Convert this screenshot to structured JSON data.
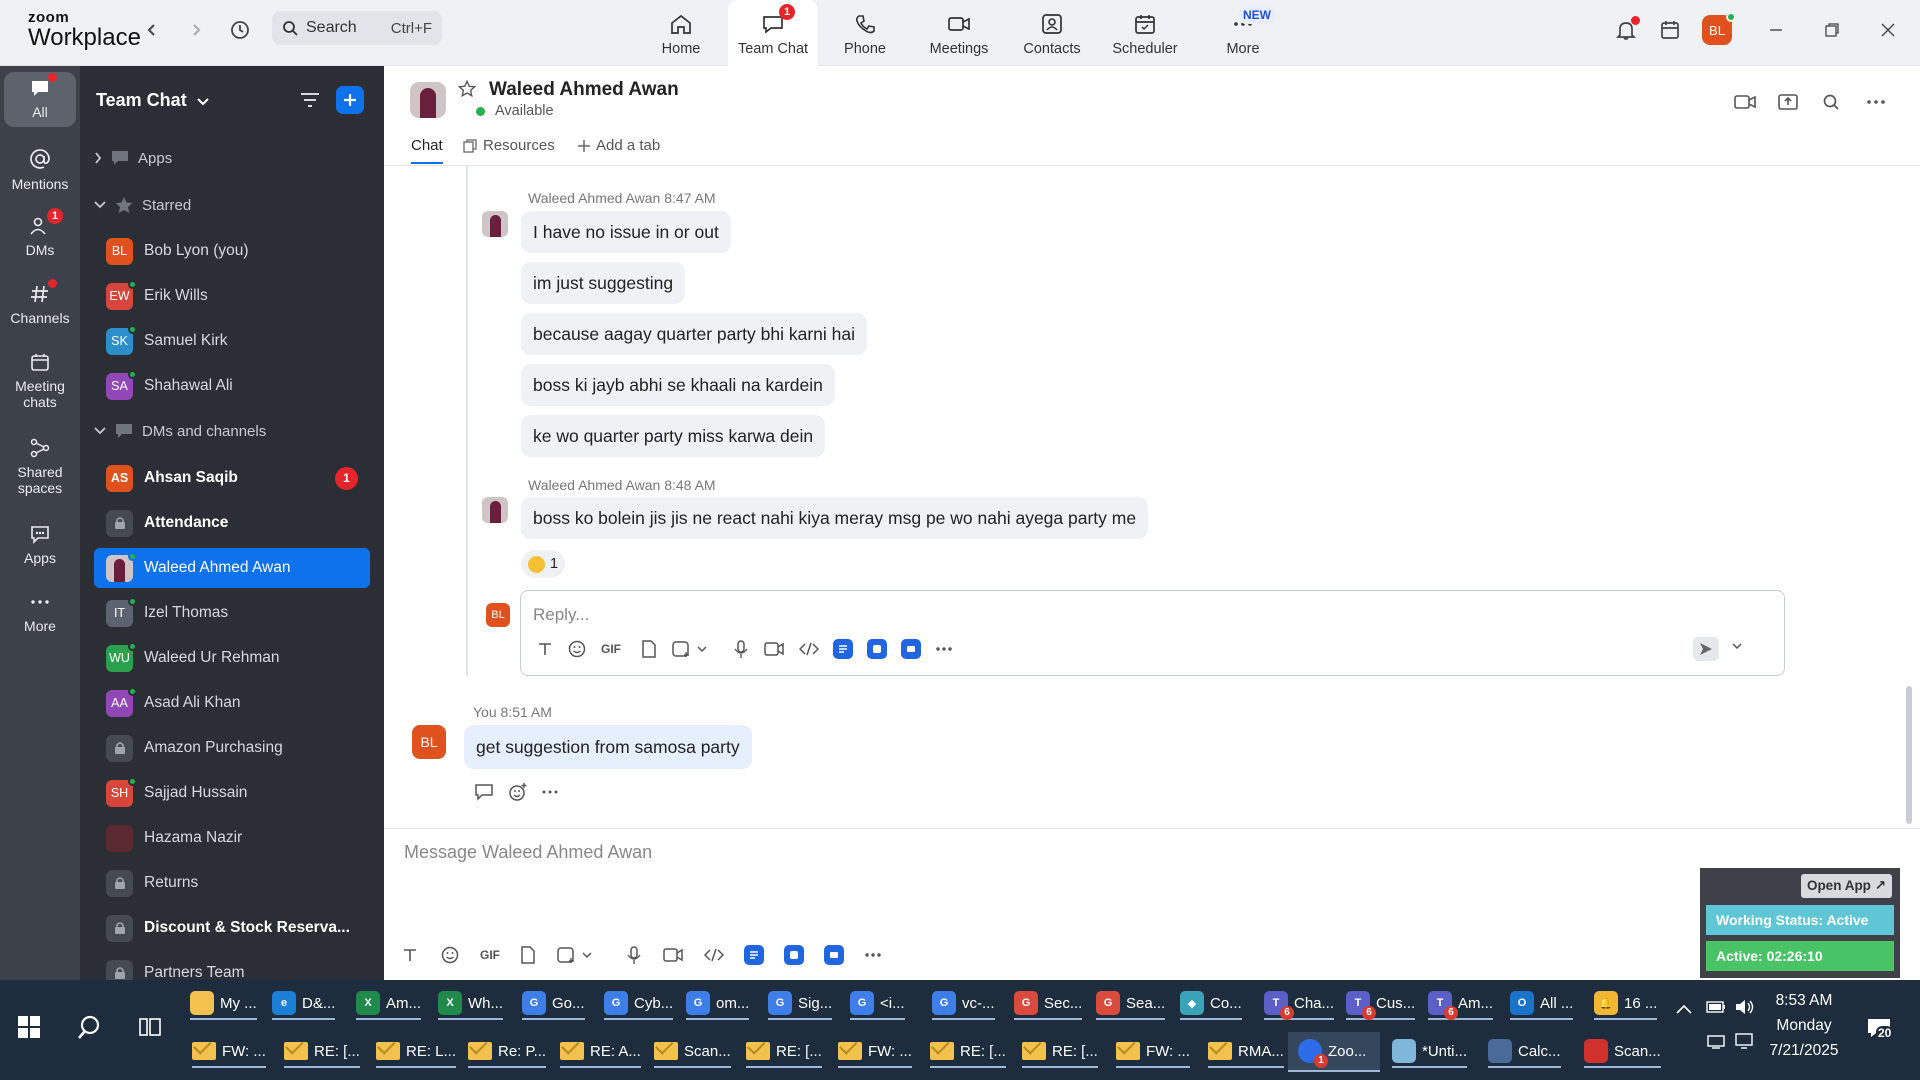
{
  "app": {
    "logo_line1": "zoom",
    "logo_line2": "Workplace"
  },
  "search": {
    "placeholder": "Search",
    "shortcut": "Ctrl+F"
  },
  "nav": [
    {
      "label": "Home",
      "icon": "home-icon"
    },
    {
      "label": "Team Chat",
      "icon": "chat-bubble-icon",
      "badge": "1",
      "active": true
    },
    {
      "label": "Phone",
      "icon": "phone-icon"
    },
    {
      "label": "Meetings",
      "icon": "video-camera-icon"
    },
    {
      "label": "Contacts",
      "icon": "contacts-icon"
    },
    {
      "label": "Scheduler",
      "icon": "calendar-icon"
    },
    {
      "label": "More",
      "icon": "more-icon",
      "new_badge": "NEW"
    }
  ],
  "user": {
    "initials": "BL",
    "color": "#e0521d"
  },
  "rail": [
    {
      "label": "All",
      "icon": "chat-icon"
    },
    {
      "label": "Mentions",
      "icon": "at-icon"
    },
    {
      "label": "DMs",
      "icon": "people-icon",
      "badge": "1"
    },
    {
      "label": "Channels",
      "icon": "hash-icon"
    },
    {
      "label": "Meeting chats",
      "icon": "meeting-chats-icon"
    },
    {
      "label": "Shared spaces",
      "icon": "shared-spaces-icon"
    },
    {
      "label": "Apps",
      "icon": "apps-icon"
    },
    {
      "label": "More",
      "icon": "ellipsis-icon"
    }
  ],
  "sidebar": {
    "title": "Team Chat",
    "sections": {
      "apps": "Apps",
      "starred": "Starred",
      "dms": "DMs and channels"
    },
    "starred": [
      {
        "name": "Bob Lyon (you)",
        "initials": "BL",
        "color": "#e0521d"
      },
      {
        "name": "Erik Wills",
        "initials": "EW",
        "color": "#d8453b"
      },
      {
        "name": "Samuel Kirk",
        "initials": "SK",
        "color": "#2d8fc9"
      },
      {
        "name": "Shahawal Ali",
        "initials": "SA",
        "color": "#9247b6"
      }
    ],
    "dms": [
      {
        "name": "Ahsan Saqib",
        "initials": "AS",
        "color": "#e0521d",
        "unread": "1",
        "bold": true
      },
      {
        "name": "Attendance",
        "lock": true,
        "bold": true
      },
      {
        "name": "Waleed Ahmed Awan",
        "photo": true,
        "selected": true
      },
      {
        "name": "Izel Thomas",
        "initials": "IT",
        "color": "#5c6270"
      },
      {
        "name": "Waleed Ur Rehman",
        "initials": "WU",
        "color": "#2aa14d"
      },
      {
        "name": "Asad Ali Khan",
        "initials": "AA",
        "color": "#9247b6"
      },
      {
        "name": "Amazon Purchasing",
        "lock": true
      },
      {
        "name": "Sajjad Hussain",
        "initials": "SH",
        "color": "#d8453b"
      },
      {
        "name": "Hazama Nazir",
        "photo2": true
      },
      {
        "name": "Returns",
        "lock": true
      },
      {
        "name": "Discount & Stock Reserva...",
        "lock": true,
        "bold": true
      },
      {
        "name": "Partners Team",
        "lock": true
      }
    ]
  },
  "chat": {
    "name": "Waleed Ahmed Awan",
    "status": "Available",
    "tabs": {
      "chat": "Chat",
      "resources": "Resources",
      "add": "Add a tab"
    }
  },
  "messages": {
    "group1_meta": "Waleed Ahmed Awan 8:47 AM",
    "group1": [
      "I have no issue in or out",
      "im just suggesting",
      "because aagay quarter party bhi karni hai",
      "boss ki jayb abhi se khaali na kardein",
      "ke wo quarter party miss karwa dein"
    ],
    "group2_meta": "Waleed Ahmed Awan 8:48 AM",
    "group2": "boss ko bolein jis jis ne react nahi kiya meray msg pe wo nahi ayega party me",
    "reaction_count": "1",
    "reply_placeholder": "Reply...",
    "mine_meta": "You 8:51 AM",
    "mine": "get suggestion from samosa party"
  },
  "composer": {
    "placeholder": "Message Waleed Ahmed Awan",
    "gif": "GIF"
  },
  "widget": {
    "open": "Open App ↗",
    "working": "Working Status: Active",
    "active": "Active: 02:26:10"
  },
  "taskbar": {
    "row1": [
      {
        "label": "My ...",
        "color": "#f2c14e",
        "glyph": ""
      },
      {
        "label": "D&...",
        "color": "#1c7fd6",
        "glyph": "e"
      },
      {
        "label": "Am...",
        "color": "#1f8a4c",
        "glyph": "X"
      },
      {
        "label": "Wh...",
        "color": "#1f8a4c",
        "glyph": "X"
      },
      {
        "label": "Go...",
        "color": "#3d7ee8",
        "glyph": "G"
      },
      {
        "label": "Cyb...",
        "color": "#3d7ee8",
        "glyph": "G"
      },
      {
        "label": "om...",
        "color": "#3d7ee8",
        "glyph": "G"
      },
      {
        "label": "Sig...",
        "color": "#3d7ee8",
        "glyph": "G"
      },
      {
        "label": "<i...",
        "color": "#3d7ee8",
        "glyph": "G"
      },
      {
        "label": "vc-...",
        "color": "#3d7ee8",
        "glyph": "G"
      },
      {
        "label": "Sec...",
        "color": "#d94c3d",
        "glyph": "G"
      },
      {
        "label": "Sea...",
        "color": "#d94c3d",
        "glyph": "G"
      },
      {
        "label": "Co...",
        "color": "#3aa3b8",
        "glyph": "◆"
      },
      {
        "label": "Cha...",
        "color": "#5b5fc7",
        "glyph": "T",
        "badge": "6"
      },
      {
        "label": "Cus...",
        "color": "#5b5fc7",
        "glyph": "T",
        "badge": "6"
      },
      {
        "label": "Am...",
        "color": "#5b5fc7",
        "glyph": "T",
        "badge": "6"
      },
      {
        "label": "All ...",
        "color": "#1a73c9",
        "glyph": "O"
      },
      {
        "label": "16 ...",
        "color": "#f2b632",
        "glyph": "🔔"
      }
    ],
    "row2": [
      {
        "label": "FW: ..."
      },
      {
        "label": "RE: [..."
      },
      {
        "label": "RE: L..."
      },
      {
        "label": "Re: P..."
      },
      {
        "label": "RE: A..."
      },
      {
        "label": "Scan..."
      },
      {
        "label": "RE: [..."
      },
      {
        "label": "FW: ..."
      },
      {
        "label": "RE: [..."
      },
      {
        "label": "RE: [..."
      },
      {
        "label": "FW: ..."
      },
      {
        "label": "RMA..."
      },
      {
        "label": "Zoo...",
        "zoom": true,
        "badge": "1"
      },
      {
        "label": "*Unti...",
        "app": "#7fb6d9"
      },
      {
        "label": "Calc...",
        "app": "#4a6a9a"
      },
      {
        "label": "Scan...",
        "app": "#d0312d"
      }
    ],
    "time": "8:53 AM",
    "day": "Monday",
    "date": "7/21/2025",
    "notifications": "20"
  }
}
